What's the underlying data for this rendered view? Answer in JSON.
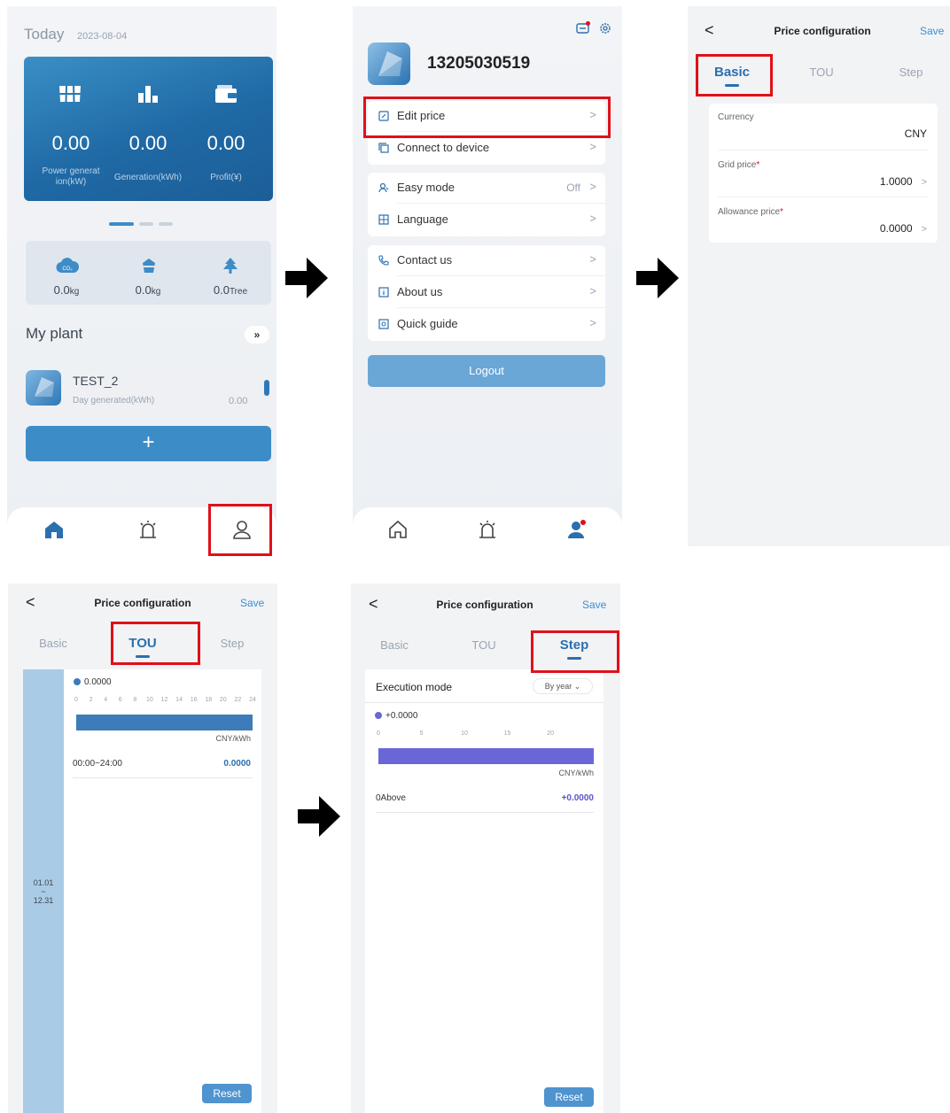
{
  "screen1": {
    "today_label": "Today",
    "date": "2023-08-04",
    "stats": [
      {
        "icon": "solar-panel-icon",
        "value": "0.00",
        "label": "Power generat ion(kW)"
      },
      {
        "icon": "bar-chart-icon",
        "value": "0.00",
        "label": "Generation(kWh)"
      },
      {
        "icon": "wallet-icon",
        "value": "0.00",
        "label": "Profit(¥)"
      }
    ],
    "env": [
      {
        "icon": "co2-cloud-icon",
        "value": "0.0",
        "unit": "kg"
      },
      {
        "icon": "coal-icon",
        "value": "0.0",
        "unit": "kg"
      },
      {
        "icon": "tree-icon",
        "value": "0.0",
        "unit": "Tree"
      }
    ],
    "my_plant_label": "My plant",
    "more_label": "»",
    "plant": {
      "name": "TEST_2",
      "day_label": "Day generated(kWh)",
      "day_value": "0.00"
    },
    "add_label": "+",
    "tabs": [
      "home-tab",
      "alarm-tab",
      "profile-tab"
    ]
  },
  "screen2": {
    "phone": "13205030519",
    "groups": [
      [
        {
          "name": "edit-price",
          "icon": "edit-icon",
          "label": "Edit price",
          "value": ""
        },
        {
          "name": "connect-device",
          "icon": "copy-icon",
          "label": "Connect to device",
          "value": ""
        }
      ],
      [
        {
          "name": "easy-mode",
          "icon": "user-mode-icon",
          "label": "Easy mode",
          "value": "Off"
        },
        {
          "name": "language",
          "icon": "grid-icon",
          "label": "Language",
          "value": ""
        }
      ],
      [
        {
          "name": "contact-us",
          "icon": "phone-icon",
          "label": "Contact us",
          "value": ""
        },
        {
          "name": "about-us",
          "icon": "info-icon",
          "label": "About us",
          "value": ""
        },
        {
          "name": "quick-guide",
          "icon": "guide-icon",
          "label": "Quick guide",
          "value": ""
        }
      ]
    ],
    "logout_label": "Logout"
  },
  "price": {
    "back": "<",
    "title": "Price configuration",
    "save": "Save",
    "tabs": [
      "Basic",
      "TOU",
      "Step"
    ]
  },
  "screen3": {
    "currency_label": "Currency",
    "currency_value": "CNY",
    "grid_label": "Grid price",
    "grid_value": "1.0000",
    "allowance_label": "Allowance price",
    "allowance_value": "0.0000",
    "required_mark": "*",
    "chevron": ">"
  },
  "screen4": {
    "range_start": "01.01",
    "range_sep": "~",
    "range_end": "12.31",
    "legend_value": "0.0000",
    "ticks": [
      "0",
      "2",
      "4",
      "6",
      "8",
      "10",
      "12",
      "14",
      "16",
      "18",
      "20",
      "22",
      "24"
    ],
    "unit": "CNY/kWh",
    "period": "00:00~24:00",
    "period_value": "0.0000",
    "reset_label": "Reset",
    "bar_color": "#3d7cb8"
  },
  "screen5": {
    "exec_label": "Execution mode",
    "mode_label": "By year",
    "legend_value": "+0.0000",
    "ticks": [
      "0",
      "5",
      "10",
      "15",
      "20"
    ],
    "unit": "CNY/kWh",
    "step_label": "0Above",
    "step_value": "+0.0000",
    "reset_label": "Reset",
    "bar_color": "#6a66d8"
  }
}
